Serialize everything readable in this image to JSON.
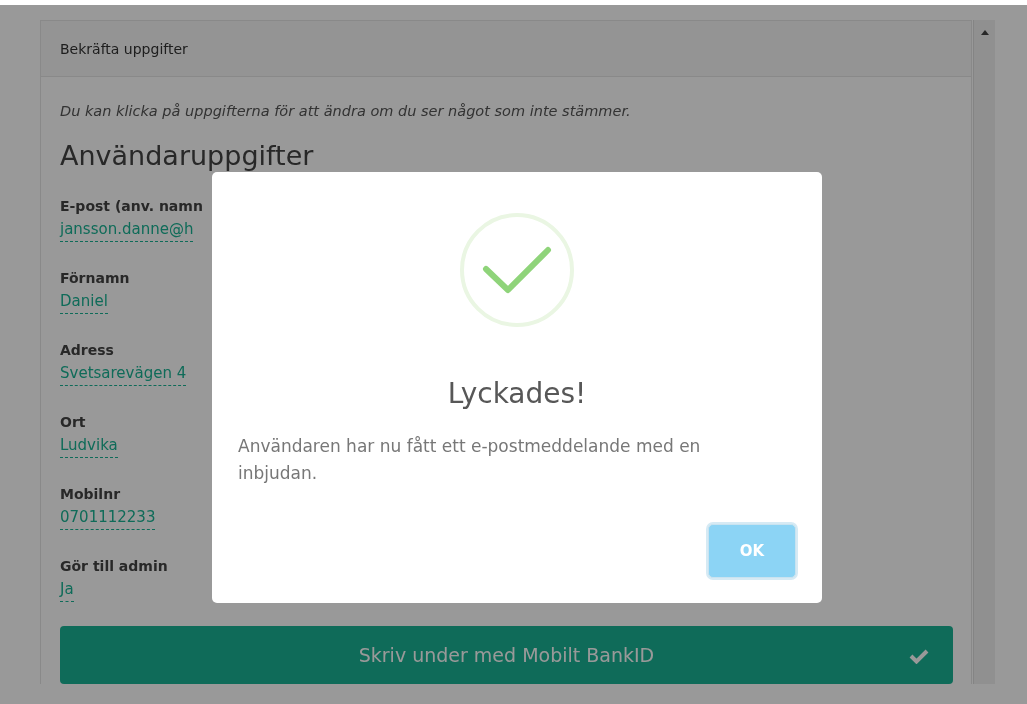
{
  "panel": {
    "title": "Bekräfta uppgifter",
    "hint": "Du kan klicka på uppgifterna för att ändra om du ser något som inte stämmer.",
    "heading": "Användaruppgifter",
    "fields": [
      {
        "label": "E-post (anv. namn",
        "value": "jansson.danne@h"
      },
      {
        "label": "Förnamn",
        "value": "Daniel"
      },
      {
        "label": "Adress",
        "value": "Svetsarevägen 4"
      },
      {
        "label": "Ort",
        "value": "Ludvika"
      },
      {
        "label": "Mobilnr",
        "value": "0701112233"
      },
      {
        "label": "Gör till admin",
        "value": "Ja"
      }
    ],
    "sign_button": "Skriv under med Mobilt BankID"
  },
  "dialog": {
    "title": "Lyckades!",
    "message": "Användaren har nu fått ett e-postmeddelande med en inbjudan.",
    "ok_button": "OK"
  }
}
